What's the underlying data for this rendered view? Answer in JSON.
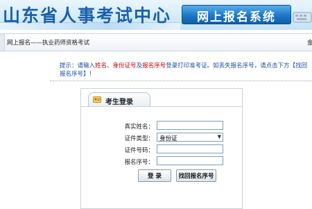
{
  "header": {
    "site_title": "山东省人事考试中心",
    "registration_system": "网上报名系统"
  },
  "breadcrumb": {
    "text": "网上报名——执业药师资格考试",
    "trailing": "金"
  },
  "tip": {
    "p1": "提示：请输入",
    "r1": "姓名",
    "p2": "、",
    "r2": "身份证号",
    "p3": "及",
    "r3": "报名序号",
    "p4": "登录打印准考证。如丢失报名序号，请点击下方【找回报名序号】！"
  },
  "login": {
    "title": "考生登录",
    "name_label": "真实姓名：",
    "name_value": "",
    "id_type_label": "证件类型：",
    "id_type_value": "身份证",
    "id_number_label": "证件号码：",
    "id_number_value": "",
    "reg_number_label": "报名序号：",
    "reg_number_value": "",
    "login_button": "登 录",
    "recover_button": "找回报名序号"
  },
  "colors": {
    "title_blue": "#1c5fa8",
    "tip_blue": "#1a4fa0",
    "tip_red": "#d10000",
    "badge_blue": "#1d78c8"
  }
}
